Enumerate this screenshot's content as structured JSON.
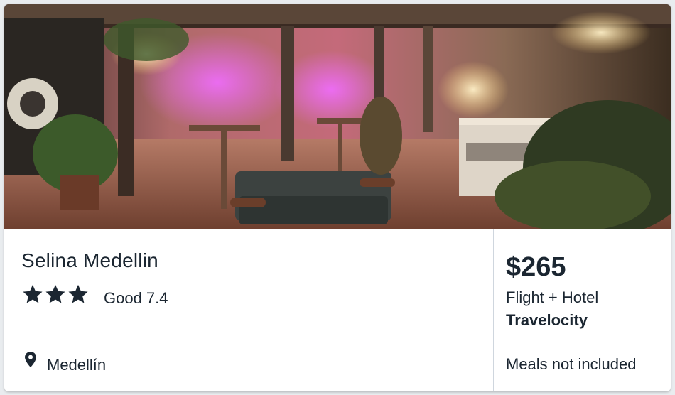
{
  "hotel": {
    "name": "Selina Medellin",
    "star_count": 3,
    "rating_label": "Good 7.4",
    "location": "Medellín"
  },
  "offer": {
    "price": "$265",
    "package": "Flight + Hotel",
    "provider": "Travelocity",
    "meals": "Meals not included"
  },
  "icons": {
    "star": "star-icon",
    "location": "location-pin-icon"
  },
  "colors": {
    "text": "#1b2631",
    "divider": "#cfd6de"
  }
}
